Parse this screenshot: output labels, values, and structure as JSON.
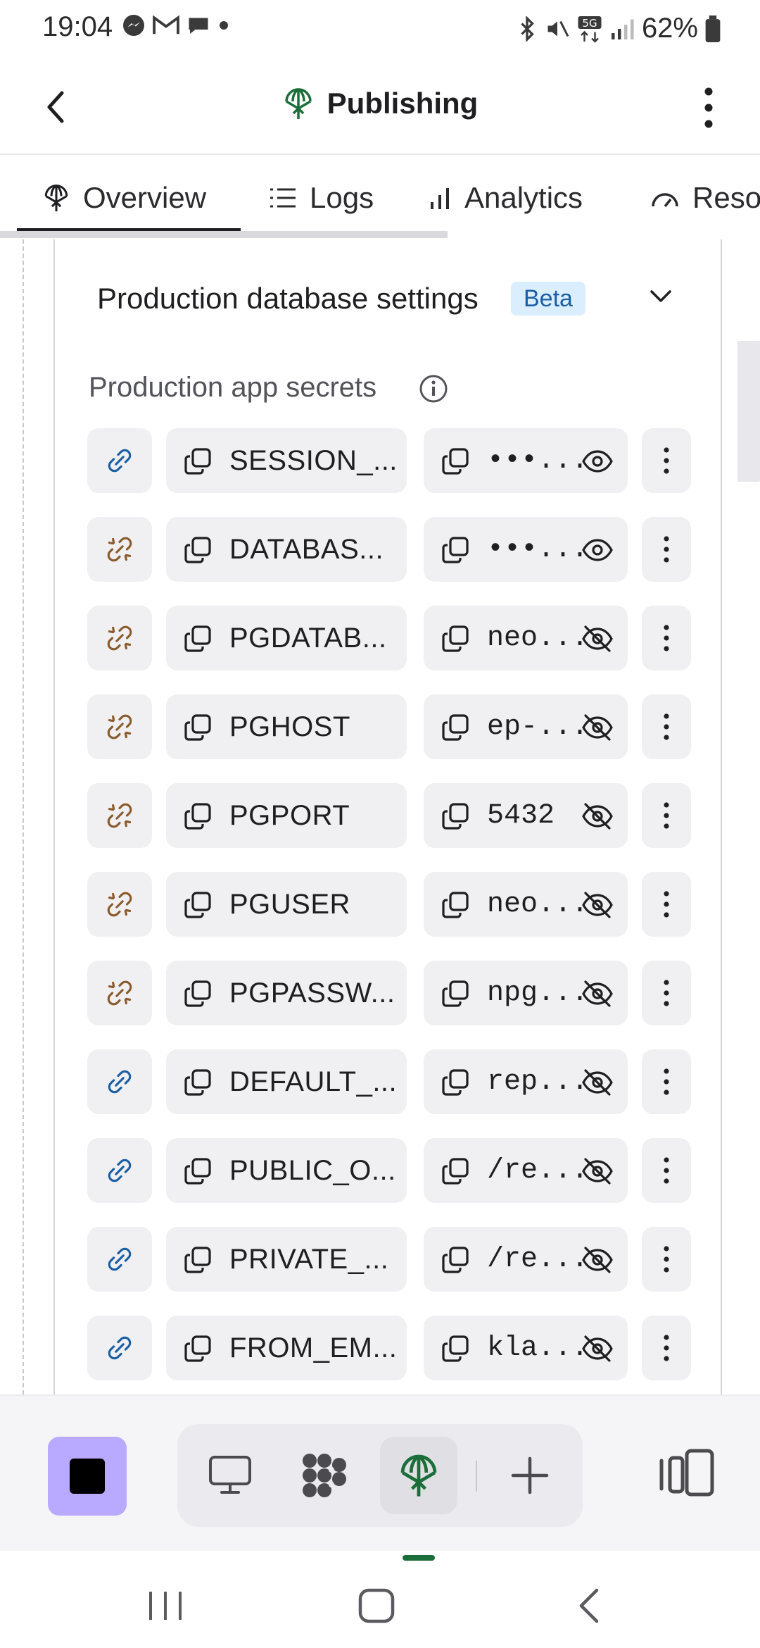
{
  "status_bar": {
    "time": "19:04",
    "left_icons": [
      "messenger-icon",
      "gmail-icon",
      "chat-icon",
      "dot-icon"
    ],
    "right_icons": [
      "bluetooth-icon",
      "mute-icon",
      "5g-icon",
      "signal-icon",
      "battery-icon"
    ],
    "battery": "62%"
  },
  "app_bar": {
    "title": "Publishing",
    "title_icon": "publishing-icon"
  },
  "tabs": [
    {
      "label": "Overview",
      "icon": "publishing-icon",
      "active": true
    },
    {
      "label": "Logs",
      "icon": "list-icon",
      "active": false
    },
    {
      "label": "Analytics",
      "icon": "bar-chart-icon",
      "active": false
    },
    {
      "label": "Reso",
      "icon": "gauge-icon",
      "active": false
    }
  ],
  "section": {
    "title": "Production database settings",
    "badge": "Beta",
    "secrets_label": "Production app secrets"
  },
  "secrets": [
    {
      "link": "linked",
      "key": "SESSION_...",
      "value": "•••...",
      "visible": false
    },
    {
      "link": "broken",
      "key": "DATABAS...",
      "value": "•••...",
      "visible": false
    },
    {
      "link": "broken",
      "key": "PGDATAB...",
      "value": "neo...",
      "visible": true
    },
    {
      "link": "broken",
      "key": "PGHOST",
      "value": "ep-...",
      "visible": true
    },
    {
      "link": "broken",
      "key": "PGPORT",
      "value": "5432",
      "visible": true
    },
    {
      "link": "broken",
      "key": "PGUSER",
      "value": "neo...",
      "visible": true
    },
    {
      "link": "broken",
      "key": "PGPASSW...",
      "value": "npg...",
      "visible": true
    },
    {
      "link": "linked",
      "key": "DEFAULT_...",
      "value": "rep...",
      "visible": true
    },
    {
      "link": "linked",
      "key": "PUBLIC_O...",
      "value": "/re...",
      "visible": true
    },
    {
      "link": "linked",
      "key": "PRIVATE_...",
      "value": "/re...",
      "visible": true
    },
    {
      "link": "linked",
      "key": "FROM_EM...",
      "value": "kla...",
      "visible": true
    }
  ],
  "colors": {
    "brand_green": "#1b6e3a",
    "link_blue": "#1a5fa3",
    "link_broken": "#8a5a2b",
    "stop_button": "#b9a9ff"
  },
  "dock": {
    "buttons": [
      "stop-icon",
      "desktop-icon",
      "integrations-icon",
      "publishing-icon",
      "plus-icon",
      "panels-icon"
    ]
  }
}
